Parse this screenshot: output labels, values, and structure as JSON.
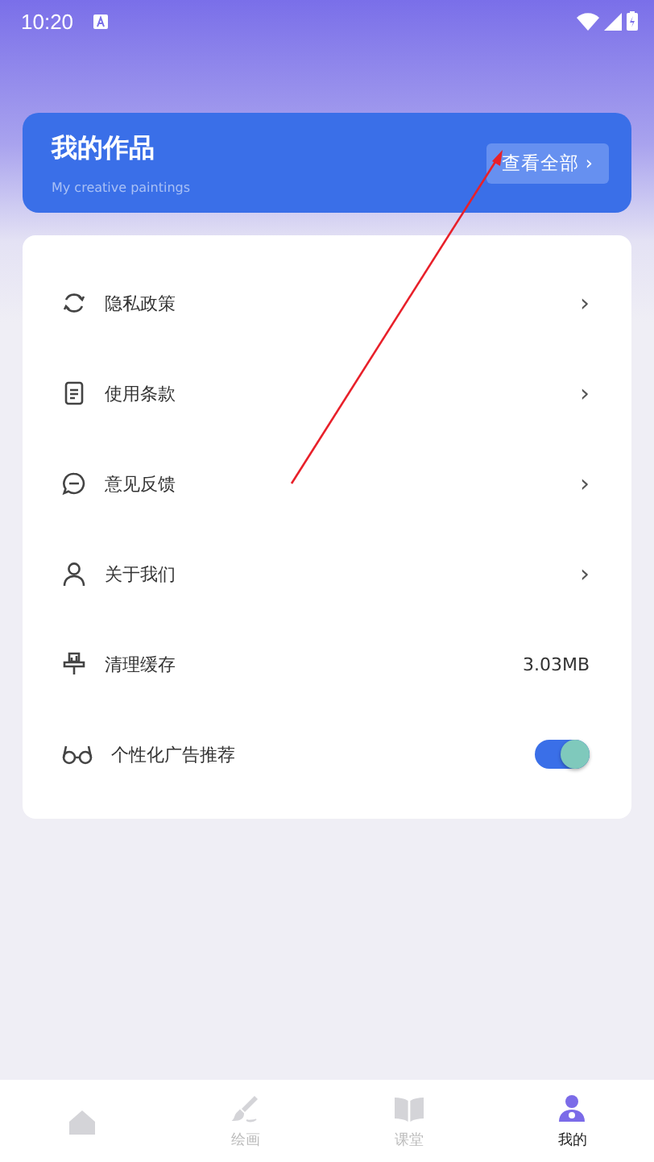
{
  "status_bar": {
    "time": "10:20"
  },
  "works_card": {
    "title": "我的作品",
    "subtitle": "My creative paintings",
    "button": "查看全部 ›"
  },
  "settings": [
    {
      "kind": "link",
      "label": "隐私政策",
      "chevron": "›"
    },
    {
      "kind": "link",
      "label": "使用条款",
      "chevron": "›"
    },
    {
      "kind": "link",
      "label": "意见反馈",
      "chevron": "›"
    },
    {
      "kind": "link",
      "label": "关于我们",
      "chevron": "›"
    },
    {
      "kind": "value",
      "label": "清理缓存",
      "value": "3.03MB"
    },
    {
      "kind": "toggle",
      "label": "个性化广告推荐",
      "on": true
    }
  ],
  "bottom_nav": [
    {
      "selected": false
    },
    {
      "label": "绘画",
      "selected": false
    },
    {
      "label": "课堂",
      "selected": false
    },
    {
      "label": "我的",
      "selected": true
    }
  ]
}
